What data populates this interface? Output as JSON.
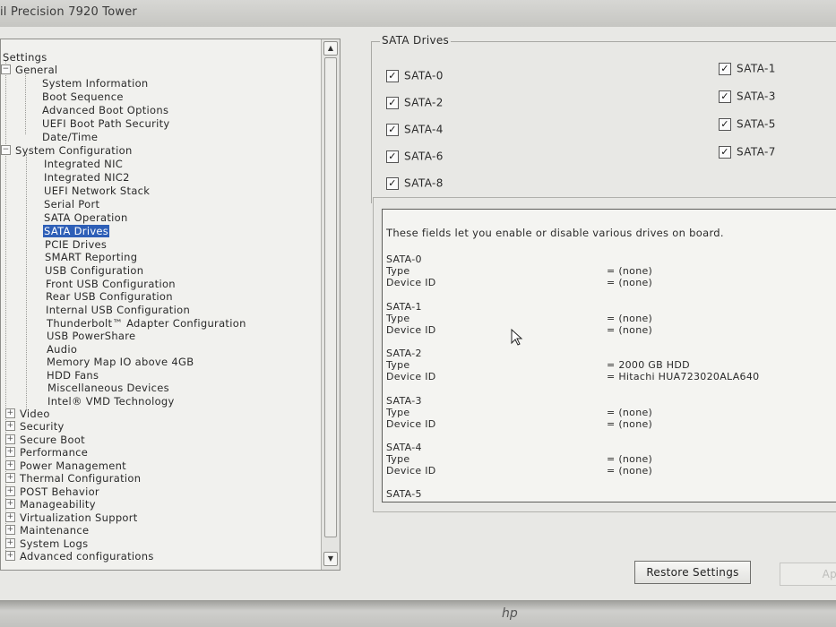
{
  "window": {
    "title": "il Precision 7920 Tower"
  },
  "tree": {
    "root_label": "Settings",
    "general": {
      "label": "General",
      "expanded_sign": "−",
      "items": [
        "System Information",
        "Boot Sequence",
        "Advanced Boot Options",
        "UEFI Boot Path Security",
        "Date/Time"
      ]
    },
    "system_configuration": {
      "label": "System Configuration",
      "expanded_sign": "−",
      "items": [
        "Integrated NIC",
        "Integrated NIC2",
        "UEFI Network Stack",
        "Serial Port",
        "SATA Operation",
        "SATA Drives",
        "PCIE Drives",
        "SMART Reporting",
        "USB Configuration",
        "Front USB Configuration",
        "Rear USB Configuration",
        "Internal USB Configuration",
        "Thunderbolt™ Adapter Configuration",
        "USB PowerShare",
        "Audio",
        "Memory Map IO above 4GB",
        "HDD Fans",
        "Miscellaneous Devices",
        "Intel® VMD Technology"
      ],
      "selected": "SATA Drives"
    },
    "collapsed_sign": "+",
    "collapsed": [
      "Video",
      "Security",
      "Secure Boot",
      "Performance",
      "Power Management",
      "Thermal Configuration",
      "POST Behavior",
      "Manageability",
      "Virtualization Support",
      "Maintenance",
      "System Logs",
      "Advanced configurations"
    ]
  },
  "scrollbar": {
    "up_arrow": "▲",
    "down_arrow": "▼"
  },
  "sata_group": {
    "title": "SATA Drives",
    "checkboxes": [
      {
        "label": "SATA-0",
        "checked": true,
        "mark": "✓"
      },
      {
        "label": "SATA-1",
        "checked": true,
        "mark": "✓"
      },
      {
        "label": "SATA-2",
        "checked": true,
        "mark": "✓"
      },
      {
        "label": "SATA-3",
        "checked": true,
        "mark": "✓"
      },
      {
        "label": "SATA-4",
        "checked": true,
        "mark": "✓"
      },
      {
        "label": "SATA-5",
        "checked": true,
        "mark": "✓"
      },
      {
        "label": "SATA-6",
        "checked": true,
        "mark": "✓"
      },
      {
        "label": "SATA-7",
        "checked": true,
        "mark": "✓"
      },
      {
        "label": "SATA-8",
        "checked": true,
        "mark": "✓"
      }
    ]
  },
  "info": {
    "description": "These fields let you enable or disable various drives on board.",
    "drives": [
      {
        "name": "SATA-0",
        "type_label": "Type",
        "type_value": "= (none)",
        "id_label": "Device ID",
        "id_value": "= (none)"
      },
      {
        "name": "SATA-1",
        "type_label": "Type",
        "type_value": "= (none)",
        "id_label": "Device ID",
        "id_value": "= (none)"
      },
      {
        "name": "SATA-2",
        "type_label": "Type",
        "type_value": "= 2000 GB HDD",
        "id_label": "Device ID",
        "id_value": "= Hitachi HUA723020ALA640"
      },
      {
        "name": "SATA-3",
        "type_label": "Type",
        "type_value": "= (none)",
        "id_label": "Device ID",
        "id_value": "= (none)"
      },
      {
        "name": "SATA-4",
        "type_label": "Type",
        "type_value": "= (none)",
        "id_label": "Device ID",
        "id_value": "= (none)"
      },
      {
        "name": "SATA-5"
      }
    ]
  },
  "buttons": {
    "restore": "Restore Settings",
    "apply": "Ap"
  },
  "bezel": {
    "logo": "hp"
  }
}
